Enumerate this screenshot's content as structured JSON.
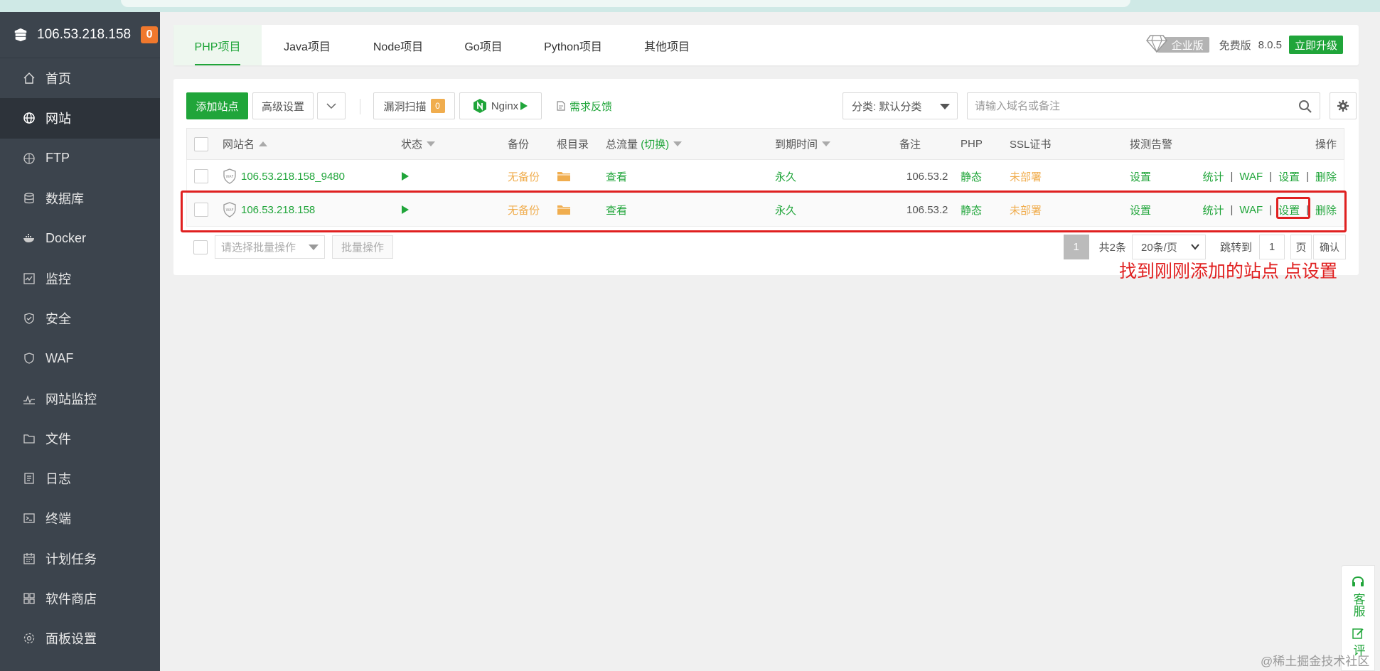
{
  "sidebar": {
    "ip": "106.53.218.158",
    "badge": "0",
    "items": [
      {
        "label": "首页"
      },
      {
        "label": "网站"
      },
      {
        "label": "FTP"
      },
      {
        "label": "数据库"
      },
      {
        "label": "Docker"
      },
      {
        "label": "监控"
      },
      {
        "label": "安全"
      },
      {
        "label": "WAF"
      },
      {
        "label": "网站监控"
      },
      {
        "label": "文件"
      },
      {
        "label": "日志"
      },
      {
        "label": "终端"
      },
      {
        "label": "计划任务"
      },
      {
        "label": "软件商店"
      },
      {
        "label": "面板设置"
      }
    ]
  },
  "tabs": [
    {
      "label": "PHP项目"
    },
    {
      "label": "Java项目"
    },
    {
      "label": "Node项目"
    },
    {
      "label": "Go项目"
    },
    {
      "label": "Python项目"
    },
    {
      "label": "其他项目"
    }
  ],
  "version": {
    "enterprise": "企业版",
    "free": "免费版",
    "number": "8.0.5",
    "upgrade": "立即升级"
  },
  "toolbar": {
    "add_site": "添加站点",
    "advanced": "高级设置",
    "vuln_scan": "漏洞扫描",
    "vuln_count": "0",
    "nginx": "Nginx",
    "feedback": "需求反馈",
    "category": "分类: 默认分类",
    "search_placeholder": "请输入域名或备注"
  },
  "table": {
    "headers": {
      "name": "网站名",
      "status": "状态",
      "backup": "备份",
      "root": "根目录",
      "traffic": "总流量",
      "traffic_toggle": "(切换)",
      "expire": "到期时间",
      "remark": "备注",
      "php": "PHP",
      "ssl": "SSL证书",
      "alert": "拨测告警",
      "ops": "操作"
    },
    "rows": [
      {
        "name": "106.53.218.158_9480",
        "backup": "无备份",
        "traffic": "查看",
        "expire": "永久",
        "remark": "106.53.2",
        "php": "静态",
        "ssl": "未部署",
        "alert": "设置",
        "op_stats": "统计",
        "op_waf": "WAF",
        "op_settings": "设置",
        "op_delete": "删除"
      },
      {
        "name": "106.53.218.158",
        "backup": "无备份",
        "traffic": "查看",
        "expire": "永久",
        "remark": "106.53.2",
        "php": "静态",
        "ssl": "未部署",
        "alert": "设置",
        "op_stats": "统计",
        "op_waf": "WAF",
        "op_settings": "设置",
        "op_delete": "删除"
      }
    ]
  },
  "batch": {
    "select_placeholder": "请选择批量操作",
    "button": "批量操作"
  },
  "pagination": {
    "current": "1",
    "total": "共2条",
    "page_size": "20条/页",
    "jump_label": "跳转到",
    "jump_value": "1",
    "unit": "页",
    "confirm": "确认"
  },
  "annotation": "找到刚刚添加的站点 点设置",
  "float_service": {
    "service": "客服",
    "review": "评"
  },
  "watermark": "@稀土掘金技术社区",
  "colors": {
    "brand_green": "#20a53a",
    "sidebar_bg": "#3c444d",
    "annotation_red": "#e02020",
    "warning_orange": "#f0ad4e"
  }
}
